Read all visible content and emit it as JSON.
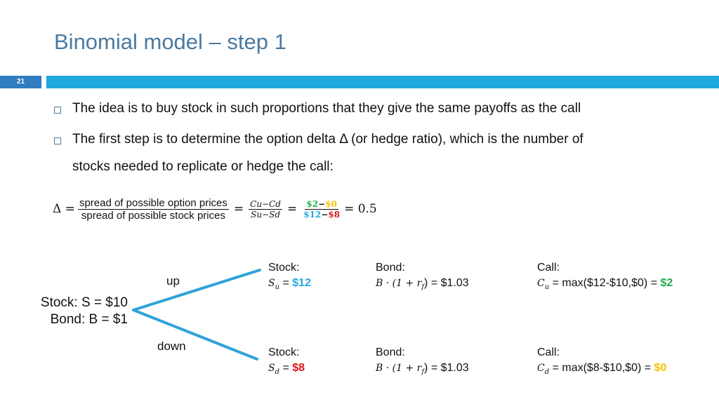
{
  "slide": {
    "title": "Binomial model – step 1",
    "number": "21",
    "colors": {
      "title": "#4a7aa0",
      "bar": "#1fa9df",
      "number_box": "#2f7cc0"
    }
  },
  "bullets": [
    {
      "icon": "square-bullet-icon",
      "text": "The idea is to buy stock in such proportions that they give the same payoffs as the call"
    },
    {
      "icon": "square-bullet-icon",
      "text": "The first step is to determine the option delta Δ (or hedge ratio), which is the number of",
      "continuation": "stocks needed to replicate or hedge the call:"
    }
  ],
  "formula": {
    "lhs": "Δ =",
    "words_num": "spread of possible option prices",
    "words_den": "spread of possible stock prices",
    "sym_num": "Cu−Cd",
    "sym_den": "Su−Sd",
    "val_num_a": "$2",
    "val_num_b": "$0",
    "val_den_a": "$12",
    "val_den_b": "$8",
    "minus": "−",
    "eq": "=",
    "result": "= 0.5"
  },
  "tree": {
    "root": {
      "stock": "Stock: S = $10",
      "bond": "Bond: B = $1"
    },
    "up_label": "up",
    "down_label": "down",
    "up": {
      "stock_label": "Stock:",
      "stock_sym": "S",
      "stock_sub": "u",
      "stock_value": "$12",
      "bond_label": "Bond:",
      "bond_expr": "B · (1 + r",
      "bond_sub": "f",
      "bond_tail": ") = $1.03",
      "call_label": "Call:",
      "call_sym": "C",
      "call_sub": "u",
      "call_expr": " = max($12-$10,$0) = ",
      "call_value": "$2"
    },
    "down": {
      "stock_label": "Stock:",
      "stock_sym": "S",
      "stock_sub": "d",
      "stock_value": "$8",
      "bond_label": "Bond:",
      "bond_expr": "B · (1 + r",
      "bond_sub": "f",
      "bond_tail": ") = $1.03",
      "call_label": "Call:",
      "call_sym": "C",
      "call_sub": "d",
      "call_expr": " = max($8-$10,$0) = ",
      "call_value": "$0"
    },
    "eq_sign": " = "
  }
}
